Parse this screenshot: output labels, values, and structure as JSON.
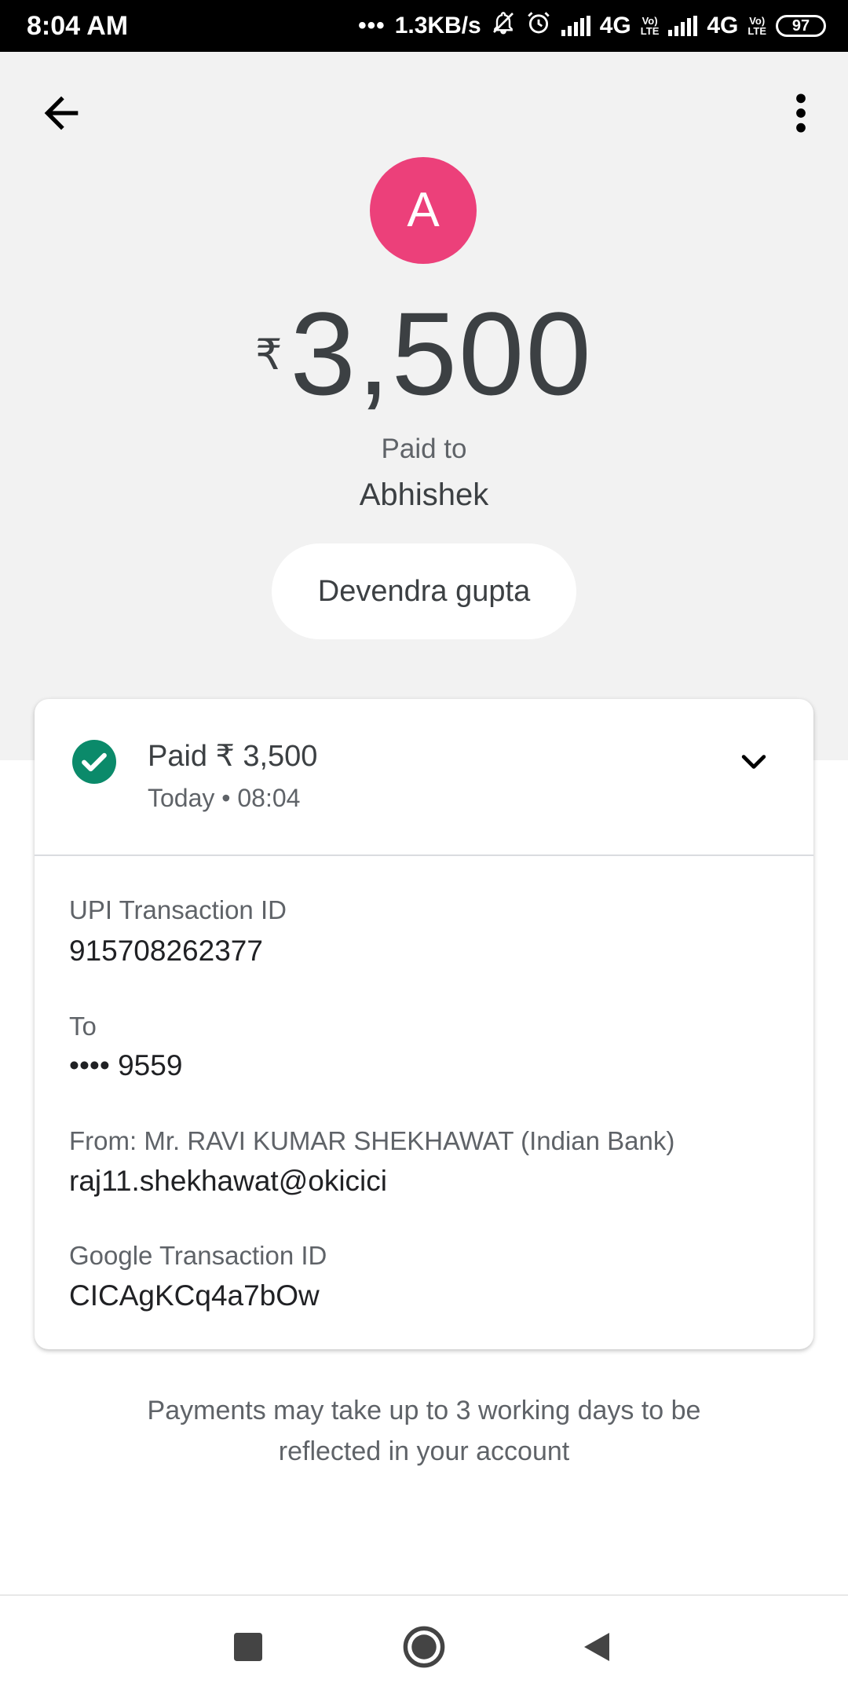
{
  "status_bar": {
    "time": "8:04 AM",
    "dots": "•••",
    "speed": "1.3KB/s",
    "network1": "4G",
    "network2": "4G",
    "volte1": "Vo) LTE",
    "volte2": "Vo) LTE",
    "battery": "97",
    "icons": [
      "notifications-off-icon",
      "alarm-icon",
      "signal-icon",
      "signal-icon"
    ]
  },
  "toolbar": {
    "back_icon": "arrow-back-icon",
    "menu_icon": "more-vert-icon"
  },
  "payee": {
    "avatar_letter": "A",
    "avatar_color": "#ec407a",
    "currency": "₹",
    "amount": "3,500",
    "paid_to_label": "Paid to",
    "name": "Abhishek",
    "chip_label": "Devendra gupta"
  },
  "details_card": {
    "status_icon": "check-circle-icon",
    "status_color": "#0b8a6a",
    "title": "Paid ₹ 3,500",
    "subtitle": "Today • 08:04",
    "expand_icon": "chevron-down-icon",
    "rows": [
      {
        "label": "UPI Transaction ID",
        "value": "915708262377"
      },
      {
        "label": "To",
        "value": "•••• 9559"
      },
      {
        "label": "From: Mr. RAVI KUMAR SHEKHAWAT (Indian Bank)",
        "value": "raj11.shekhawat@okicici"
      },
      {
        "label": "Google Transaction ID",
        "value": "CICAgKCq4a7bOw"
      }
    ]
  },
  "note": "Payments may take up to 3 working days to be reflected in your account",
  "nav_bar": {
    "recents_icon": "square-icon",
    "home_icon": "circle-icon",
    "back_icon": "triangle-back-icon"
  }
}
